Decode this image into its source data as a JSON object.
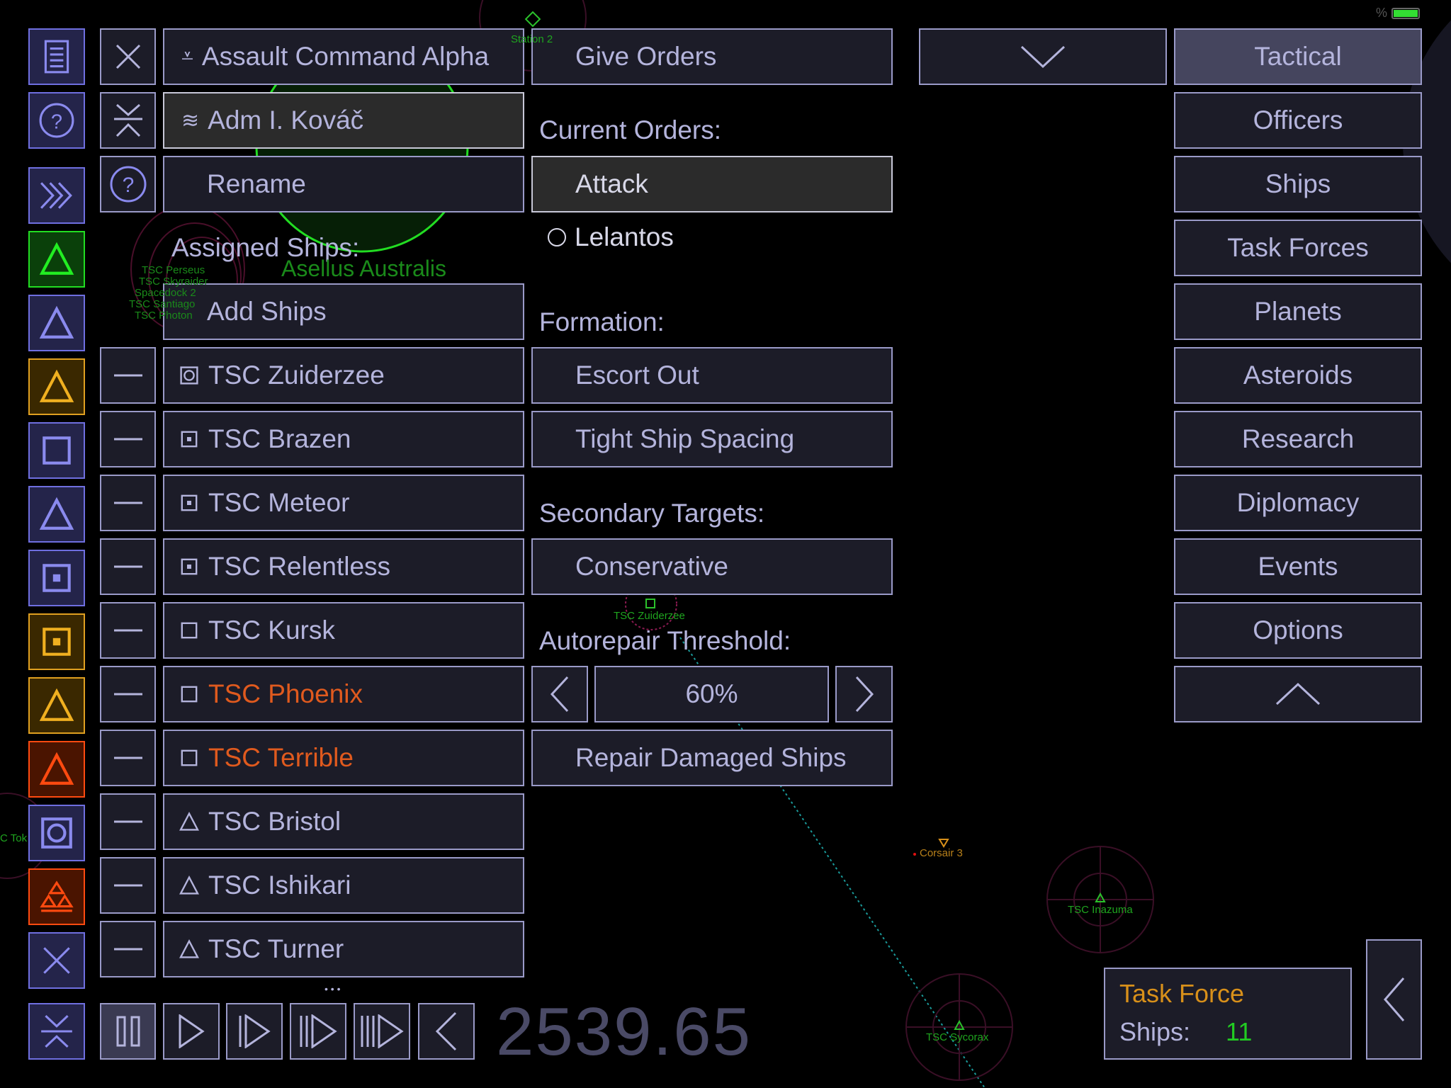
{
  "status_bar": {
    "battery_label": "%",
    "battery_level": 1.0
  },
  "left_toolbar": [
    {
      "icon": "document-list-icon",
      "style": "blue"
    },
    {
      "icon": "help-icon",
      "style": "blue"
    },
    {
      "icon": "fast-forward-chevrons-icon",
      "style": "blue"
    },
    {
      "icon": "triangle-icon",
      "style": "green"
    },
    {
      "icon": "triangle-icon",
      "style": "blue"
    },
    {
      "icon": "triangle-icon",
      "style": "orange"
    },
    {
      "icon": "square-icon",
      "style": "blue"
    },
    {
      "icon": "triangle-icon",
      "style": "blue"
    },
    {
      "icon": "square-dot-icon",
      "style": "blue"
    },
    {
      "icon": "square-dot-icon",
      "style": "orange"
    },
    {
      "icon": "triangle-icon",
      "style": "orange"
    },
    {
      "icon": "triangle-icon",
      "style": "red"
    },
    {
      "icon": "square-circle-icon",
      "style": "blue"
    },
    {
      "icon": "stacked-triangles-icon",
      "style": "red"
    },
    {
      "icon": "close-icon",
      "style": "blue"
    },
    {
      "icon": "collapse-icon",
      "style": "blue"
    }
  ],
  "task_force": {
    "name": "Assault Command Alpha",
    "commander": "Adm I. Kováč",
    "rename_label": "Rename",
    "assigned_ships_label": "Assigned Ships:",
    "add_ships_label": "Add Ships",
    "ships": [
      {
        "name": "TSC Zuiderzee",
        "icon": "square-circle-icon",
        "status": "normal"
      },
      {
        "name": "TSC Brazen",
        "icon": "square-dot-icon",
        "status": "normal"
      },
      {
        "name": "TSC Meteor",
        "icon": "square-dot-icon",
        "status": "normal"
      },
      {
        "name": "TSC Relentless",
        "icon": "square-dot-icon",
        "status": "normal"
      },
      {
        "name": "TSC Kursk",
        "icon": "square-icon",
        "status": "normal"
      },
      {
        "name": "TSC Phoenix",
        "icon": "square-icon",
        "status": "damaged"
      },
      {
        "name": "TSC Terrible",
        "icon": "square-icon",
        "status": "damaged"
      },
      {
        "name": "TSC Bristol",
        "icon": "triangle-icon",
        "status": "normal"
      },
      {
        "name": "TSC Ishikari",
        "icon": "triangle-icon",
        "status": "normal"
      },
      {
        "name": "TSC Turner",
        "icon": "triangle-icon",
        "status": "normal"
      }
    ],
    "more_indicator": "• • •"
  },
  "orders": {
    "give_orders_label": "Give Orders",
    "current_orders_label": "Current Orders:",
    "current_order": "Attack",
    "target": "Lelantos",
    "formation_label": "Formation:",
    "formation": "Escort Out",
    "spacing": "Tight Ship Spacing",
    "secondary_targets_label": "Secondary Targets:",
    "secondary_targets": "Conservative",
    "autorepair_label": "Autorepair Threshold:",
    "autorepair_value": "60%",
    "repair_label": "Repair Damaged Ships"
  },
  "nav": {
    "items": [
      "Tactical",
      "Officers",
      "Ships",
      "Task Forces",
      "Planets",
      "Asteroids",
      "Research",
      "Diplomacy",
      "Events",
      "Options"
    ],
    "selected": "Tactical"
  },
  "time_controls": {
    "clock": "2539.65"
  },
  "summary": {
    "title": "Task Force",
    "ships_label": "Ships:",
    "ships_count": "11"
  },
  "map_labels": {
    "station": "Station 2",
    "system": "Asellus Australis",
    "zuiderzee": "TSC Zuiderzee",
    "corsair": "Corsair 3",
    "inazuma": "TSC Inazuma",
    "sycorax": "TSC Sycorax",
    "tok": "C Tok",
    "cluster": [
      "TSC Perseus",
      "TSC Skyraider",
      "Spacedock 2",
      "TSC Santiago",
      "TSC Photon"
    ]
  },
  "colors": {
    "accent": "#9a9ac8",
    "text": "#b4b4dc",
    "button_bg": "#1c1c28",
    "damaged": "#e05a1e",
    "friendly": "#1fa51f",
    "warning": "#d8901a",
    "clock": "#4a4a66"
  }
}
